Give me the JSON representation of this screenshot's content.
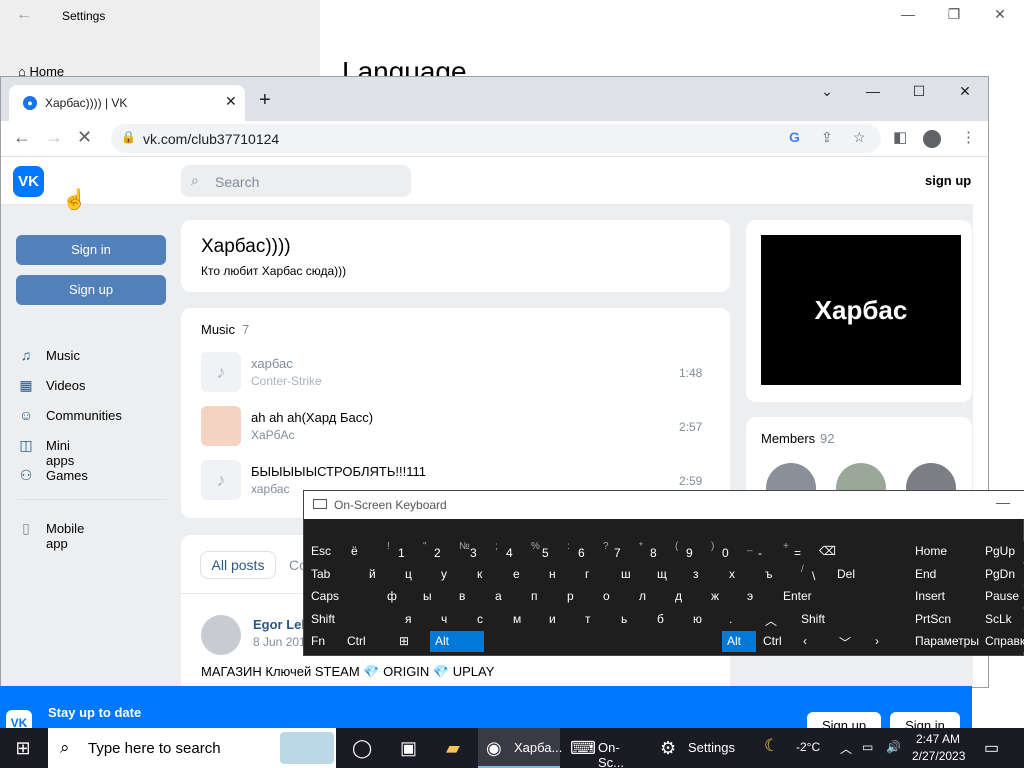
{
  "settings": {
    "title": "Settings",
    "home": "Home",
    "heading": "Language",
    "min": "—",
    "max": "❐",
    "close": "✕"
  },
  "browser": {
    "tab_title": "Харбас)))) | VK",
    "tab_close": "✕",
    "new_tab": "+",
    "url": "vk.com/club37710124",
    "win_dropdown": "⌄",
    "win_min": "—",
    "win_max": "☐",
    "win_close": "✕"
  },
  "vk": {
    "logo": "VK",
    "search_placeholder": "Search",
    "signup_top": "sign up",
    "sign_in": "Sign in",
    "sign_up": "Sign up",
    "menu": [
      {
        "icon": "♫",
        "label": "Music"
      },
      {
        "icon": "▦",
        "label": "Videos"
      },
      {
        "icon": "☺",
        "label": "Communities"
      },
      {
        "icon": "◫",
        "label": "Mini apps"
      },
      {
        "icon": "⚇",
        "label": "Games"
      }
    ],
    "mobile_app": "Mobile app",
    "group": {
      "name": "Харбас))))",
      "status": "Кто любит Харбас сюда)))"
    },
    "music": {
      "label": "Music",
      "count": "7",
      "tracks": [
        {
          "title": "харбас",
          "artist": "Conter-Strike",
          "duration": "1:48"
        },
        {
          "title": "ah ah ah(Хард Басс)",
          "artist": "ХаРбАс",
          "duration": "2:57"
        },
        {
          "title": "БЫЫЫЫЫСТРОБЛЯТЬ!!!111",
          "artist": "харбас",
          "duration": "2:59"
        }
      ]
    },
    "cover_text": "Харбас",
    "members_label": "Members",
    "members_count": "92",
    "posts": {
      "all_posts": "All posts",
      "tab2": "Co",
      "author": "Egor Leb",
      "date": "8 Jun 201",
      "text": "МАГАЗИН Ключей STEAM 💎 ORIGIN 💎 UPLAY"
    },
    "banner": {
      "logo": "VK",
      "title": "Stay up to date",
      "sign_up": "Sign up",
      "sign_in": "Sign in"
    }
  },
  "osk": {
    "title": "On-Screen Keyboard",
    "minimize": "—",
    "rows": [
      [
        {
          "l": "Esc",
          "w": 40
        },
        {
          "l": "ё",
          "w": 36
        },
        {
          "s": "!",
          "l": "1",
          "w": 36
        },
        {
          "s": "\"",
          "l": "2",
          "w": 36
        },
        {
          "s": "№",
          "l": "3",
          "w": 36
        },
        {
          "s": ";",
          "l": "4",
          "w": 36
        },
        {
          "s": "%",
          "l": "5",
          "w": 36
        },
        {
          "s": ":",
          "l": "6",
          "w": 36
        },
        {
          "s": "?",
          "l": "7",
          "w": 36
        },
        {
          "s": "*",
          "l": "8",
          "w": 36
        },
        {
          "s": "(",
          "l": "9",
          "w": 36
        },
        {
          "s": ")",
          "l": "0",
          "w": 36
        },
        {
          "s": "_",
          "l": "-",
          "w": 36
        },
        {
          "s": "+",
          "l": "=",
          "w": 36
        },
        {
          "l": "⌫",
          "w": 50
        }
      ],
      [
        {
          "l": "Tab",
          "w": 58
        },
        {
          "l": "й",
          "w": 36
        },
        {
          "l": "ц",
          "w": 36
        },
        {
          "l": "у",
          "w": 36
        },
        {
          "l": "к",
          "w": 36
        },
        {
          "l": "е",
          "w": 36
        },
        {
          "l": "н",
          "w": 36
        },
        {
          "l": "г",
          "w": 36
        },
        {
          "l": "ш",
          "w": 36
        },
        {
          "l": "щ",
          "w": 36
        },
        {
          "l": "з",
          "w": 36
        },
        {
          "l": "х",
          "w": 36
        },
        {
          "l": "ъ",
          "w": 36
        },
        {
          "s": "/",
          "l": "\\",
          "w": 36
        },
        {
          "l": "Del",
          "w": 50
        }
      ],
      [
        {
          "l": "Caps",
          "w": 76
        },
        {
          "l": "ф",
          "w": 36
        },
        {
          "l": "ы",
          "w": 36
        },
        {
          "l": "в",
          "w": 36
        },
        {
          "l": "а",
          "w": 36
        },
        {
          "l": "п",
          "w": 36
        },
        {
          "l": "р",
          "w": 36
        },
        {
          "l": "о",
          "w": 36
        },
        {
          "l": "л",
          "w": 36
        },
        {
          "l": "д",
          "w": 36
        },
        {
          "l": "ж",
          "w": 36
        },
        {
          "l": "э",
          "w": 36
        },
        {
          "l": "Enter",
          "w": 104
        }
      ],
      [
        {
          "l": "Shift",
          "w": 94
        },
        {
          "l": "я",
          "w": 36
        },
        {
          "l": "ч",
          "w": 36
        },
        {
          "l": "с",
          "w": 36
        },
        {
          "l": "м",
          "w": 36
        },
        {
          "l": "и",
          "w": 36
        },
        {
          "l": "т",
          "w": 36
        },
        {
          "l": "ь",
          "w": 36
        },
        {
          "l": "б",
          "w": 36
        },
        {
          "l": "ю",
          "w": 36
        },
        {
          "l": ".",
          "w": 36
        },
        {
          "l": "︿",
          "w": 36
        },
        {
          "l": "Shift",
          "w": 86
        }
      ],
      [
        {
          "l": "Fn",
          "w": 36
        },
        {
          "l": "Ctrl",
          "w": 52
        },
        {
          "l": "⊞",
          "w": 36
        },
        {
          "l": "Alt",
          "w": 56,
          "hi": true
        },
        {
          "l": "",
          "w": 236
        },
        {
          "l": "Alt",
          "w": 36,
          "hi": true
        },
        {
          "l": "Ctrl",
          "w": 40
        },
        {
          "l": "‹",
          "w": 36
        },
        {
          "l": "﹀",
          "w": 36
        },
        {
          "l": "›",
          "w": 36
        },
        {
          "l": "▤",
          "w": 38
        }
      ]
    ],
    "nav": [
      [
        "Home",
        "PgUp"
      ],
      [
        "End",
        "PgDn"
      ],
      [
        "Insert",
        "Pause"
      ],
      [
        "PrtScn",
        "ScLk"
      ],
      [
        "Параметры",
        "Справка"
      ]
    ]
  },
  "taskbar": {
    "search_placeholder": "Type here to search",
    "apps": [
      {
        "icon": "◉",
        "label": "Харба...",
        "active": true
      },
      {
        "icon": "⌨",
        "label": "On-Sc...",
        "active": false
      },
      {
        "icon": "⚙",
        "label": "Settings",
        "active": false
      }
    ],
    "weather": "-2°C",
    "time": "2:47 AM",
    "date": "2/27/2023"
  }
}
